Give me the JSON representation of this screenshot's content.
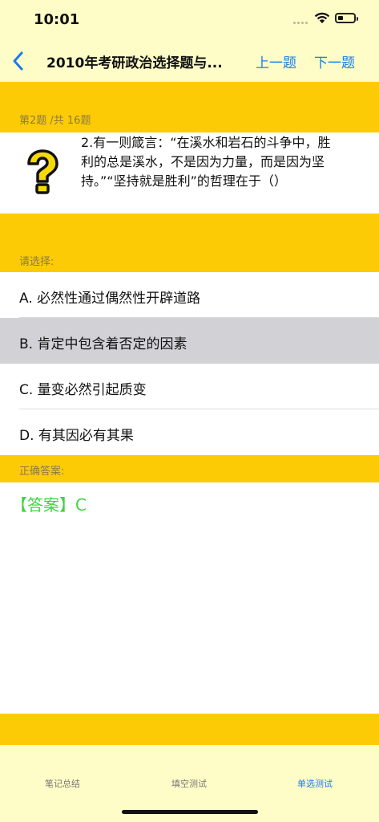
{
  "status_bar": {
    "time": "10:01"
  },
  "nav": {
    "title": "2010年考研政治选择题与...",
    "prev_label": "上一题",
    "next_label": "下一题"
  },
  "question": {
    "counter": "第2题 /共 16题",
    "text": "2.有一则箴言：“在溪水和岩石的斗争中，胜利的总是溪水，不是因为力量，而是因为坚持。”“坚持就是胜利”的哲理在于（）",
    "icon": "question-mark-icon"
  },
  "choose_label": "请选择:",
  "options": [
    {
      "label": "A.  必然性通过偶然性开辟道路",
      "selected": false
    },
    {
      "label": "B.  肯定中包含着否定的因素",
      "selected": true
    },
    {
      "label": "C.  量变必然引起质变",
      "selected": false
    },
    {
      "label": "D.  有其因必有其果",
      "selected": false
    }
  ],
  "answer_label": "正确答案:",
  "answer_text": "【答案】C",
  "tabs": [
    {
      "label": "笔记总结",
      "active": false
    },
    {
      "label": "填空测试",
      "active": false
    },
    {
      "label": "单选测试",
      "active": true
    }
  ],
  "colors": {
    "accent": "#1a7cf2",
    "band": "#fdcb05",
    "background": "#fefcc7",
    "answer": "#3fd43f",
    "selected": "#d2d2d6"
  }
}
